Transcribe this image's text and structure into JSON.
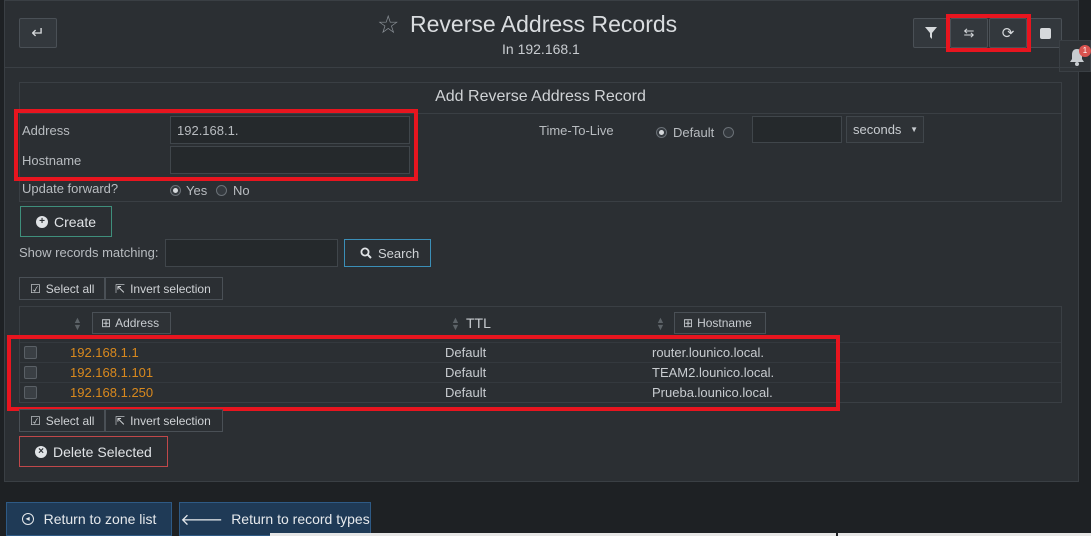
{
  "header": {
    "title": "Reverse Address Records",
    "subtitle": "In 192.168.1",
    "back_icon": "return-arrow-icon",
    "toolbar_icons": [
      "filter-icon",
      "repeat-icon",
      "refresh-icon",
      "square-icon"
    ],
    "notification_count": "1"
  },
  "form": {
    "title": "Add Reverse Address Record",
    "address_label": "Address",
    "address_value": "192.168.1.",
    "hostname_label": "Hostname",
    "hostname_value": "",
    "ttl_label": "Time-To-Live",
    "ttl_default_label": "Default",
    "ttl_value": "",
    "ttl_unit": "seconds",
    "update_forward_label": "Update forward?",
    "yes_label": "Yes",
    "no_label": "No",
    "create_label": "Create"
  },
  "search": {
    "label": "Show records matching:",
    "value": "",
    "button_label": "Search"
  },
  "selection": {
    "select_all": "Select all",
    "invert": "Invert selection"
  },
  "table": {
    "columns": [
      "Address",
      "TTL",
      "Hostname"
    ],
    "rows": [
      {
        "address": "192.168.1.1",
        "ttl": "Default",
        "hostname": "router.lounico.local."
      },
      {
        "address": "192.168.1.101",
        "ttl": "Default",
        "hostname": "TEAM2.lounico.local."
      },
      {
        "address": "192.168.1.250",
        "ttl": "Default",
        "hostname": "Prueba.lounico.local."
      }
    ]
  },
  "delete_label": "Delete Selected",
  "footer": {
    "return_zone": "Return to zone list",
    "return_types": "Return to record types"
  },
  "colors": {
    "highlight": "#e8151f",
    "address_link": "#d8891e",
    "background": "#2b2f33"
  }
}
